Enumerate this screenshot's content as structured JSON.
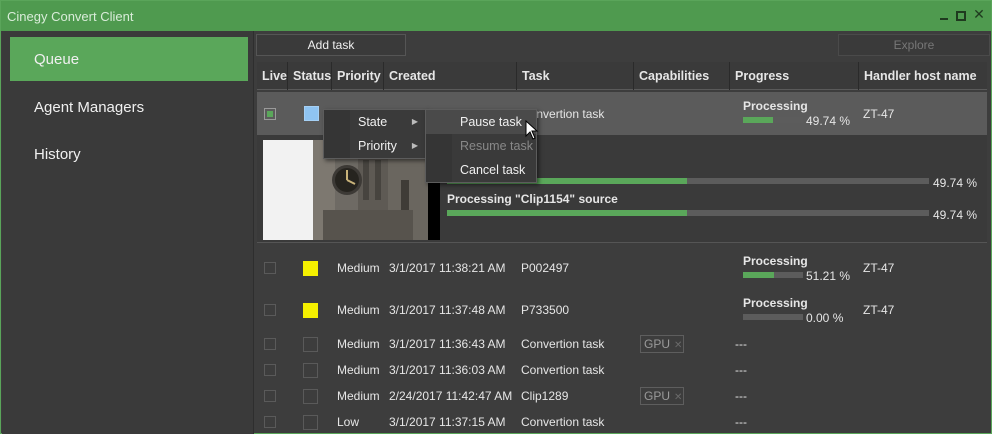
{
  "window": {
    "title": "Cinegy Convert Client"
  },
  "sidebar": {
    "items": [
      {
        "label": "Queue",
        "active": true
      },
      {
        "label": "Agent Managers"
      },
      {
        "label": "History"
      }
    ]
  },
  "toolbar": {
    "add_task": "Add task",
    "explore": "Explore"
  },
  "columns": [
    "Live",
    "Status",
    "Priority",
    "Created",
    "Task",
    "Capabilities",
    "Progress",
    "Handler host name"
  ],
  "selected_row": {
    "task": "Convertion task",
    "progress_label": "Processing",
    "progress_value": "49.74 %",
    "progress": 0.4974,
    "host": "ZT-47"
  },
  "expanded": {
    "step1_value": "49.74 %",
    "step1": 0.4974,
    "step2_label": "Processing \"Clip1154\" source",
    "step2_value": "49.74 %",
    "step2": 0.4974
  },
  "rows": [
    {
      "priority": "Medium",
      "created": "3/1/2017 11:38:21 AM",
      "task": "P002497",
      "capability": "",
      "progress_label": "Processing",
      "progress_value": "51.21 %",
      "progress": 0.5121,
      "host": "ZT-47",
      "status": "yellow"
    },
    {
      "priority": "Medium",
      "created": "3/1/2017 11:37:48 AM",
      "task": "P733500",
      "capability": "",
      "progress_label": "Processing",
      "progress_value": "0.00 %",
      "progress": 0.0,
      "host": "ZT-47",
      "status": "yellow"
    },
    {
      "priority": "Medium",
      "created": "3/1/2017 11:36:43 AM",
      "task": "Convertion task",
      "capability": "GPU",
      "progress_text": "---",
      "host": "",
      "status": "none"
    },
    {
      "priority": "Medium",
      "created": "3/1/2017 11:36:03 AM",
      "task": "Convertion task",
      "capability": "",
      "progress_text": "---",
      "host": "",
      "status": "none"
    },
    {
      "priority": "Medium",
      "created": "2/24/2017 11:42:47 AM",
      "task": "Clip1289",
      "capability": "GPU",
      "progress_text": "---",
      "host": "",
      "status": "none"
    },
    {
      "priority": "Low",
      "created": "3/1/2017 11:37:15 AM",
      "task": "Convertion task",
      "capability": "",
      "progress_text": "---",
      "host": "",
      "status": "none"
    }
  ],
  "context_menu": {
    "state": "State",
    "priority": "Priority"
  },
  "submenu": {
    "pause": "Pause task",
    "resume": "Resume task",
    "cancel": "Cancel task"
  },
  "colors": {
    "accent": "#5aa75a",
    "status_yellow": "#f5f000",
    "status_blue": "#8fc4f2"
  }
}
